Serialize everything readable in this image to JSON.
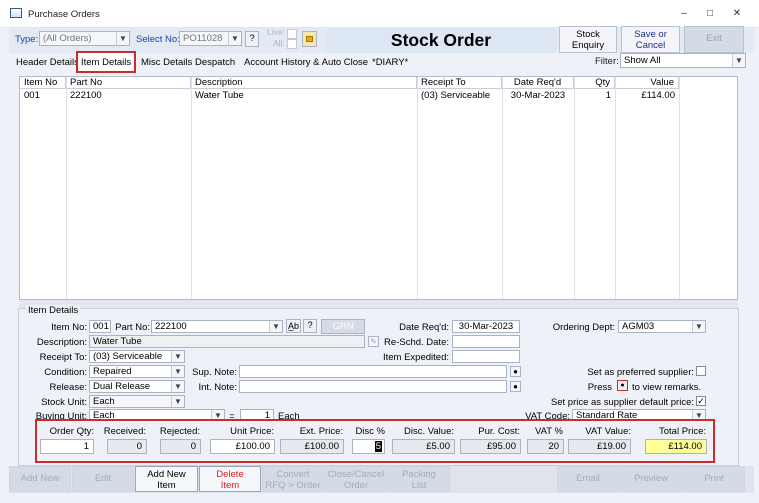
{
  "window": {
    "title": "Purchase Orders",
    "minimize": "–",
    "restore": "□",
    "close": "✕"
  },
  "top": {
    "type_label": "Type:",
    "type_value": "(All Orders)",
    "select_label": "Select No:",
    "select_value": "PO11028",
    "help_btn": "?",
    "live_label": "Live:",
    "all_label": "All:",
    "title": "Stock Order",
    "stock_enquiry": [
      "Stock",
      "Enquiry"
    ],
    "save_cancel": [
      "Save or",
      "Cancel"
    ],
    "exit": "Exit"
  },
  "tabs": [
    "Header Details",
    "Item Details",
    "Misc Details",
    "Despatch",
    "Account History & Auto Close",
    "*DIARY*"
  ],
  "filter": {
    "label": "Filter:",
    "value": "Show All"
  },
  "grid": {
    "columns": [
      "Item No",
      "Part No",
      "Description",
      "Receipt To",
      "Date Req'd",
      "Qty",
      "Value"
    ],
    "rows": [
      [
        "001",
        "222100",
        "Water Tube",
        "(03) Serviceable",
        "30-Mar-2023",
        "1",
        "£114.00"
      ]
    ]
  },
  "details": {
    "legend": "Item Details",
    "item_no_label": "Item No:",
    "item_no": "001",
    "part_no_label": "Part No:",
    "part_no": "222100",
    "ab_btn": "A̲b",
    "q_btn": "?",
    "grn_btn": "GRN",
    "date_reqd_label": "Date Req'd:",
    "date_reqd": "30-Mar-2023",
    "ordering_dept_label": "Ordering Dept:",
    "ordering_dept": "AGM03",
    "description_label": "Description:",
    "description": "Water Tube",
    "reschd_label": "Re-Schd. Date:",
    "reschd": "",
    "receipt_to_label": "Receipt To:",
    "receipt_to": "(03) Serviceable",
    "item_expedited_label": "Item Expedited:",
    "item_expedited": "",
    "condition_label": "Condition:",
    "condition": "Repaired",
    "sup_note_label": "Sup. Note:",
    "sup_note": "",
    "pref_supplier_label": "Set as preferred supplier:",
    "release_label": "Release:",
    "release": "Dual Release",
    "int_note_label": "Int. Note:",
    "int_note": "",
    "press_label": "Press",
    "view_remarks": "to view remarks.",
    "stock_unit_label": "Stock Unit:",
    "stock_unit": "Each",
    "default_price_label": "Set price as supplier default price:",
    "buying_unit_label": "Buying Unit:",
    "buying_unit": "Each",
    "eq": "=",
    "conv_qty": "1",
    "conv_unit": "Each",
    "vat_code_label": "VAT Code:",
    "vat_code": "Standard Rate"
  },
  "totals": {
    "labels": [
      "Order Qty:",
      "Received:",
      "Rejected:",
      "Unit Price:",
      "Ext. Price:",
      "Disc %",
      "Disc. Value:",
      "Pur. Cost:",
      "VAT %",
      "VAT Value:",
      "Total Price:"
    ],
    "values": [
      "1",
      "0",
      "0",
      "£100.00",
      "£100.00",
      "5",
      "£5.00",
      "£95.00",
      "20",
      "£19.00",
      "£114.00"
    ]
  },
  "bottom": {
    "add_new_top": "Add New",
    "edit": "Edit",
    "add_item": [
      "Add New",
      "Item"
    ],
    "delete_item": [
      "Delete",
      "Item"
    ],
    "convert": [
      "Convert",
      "RFQ > Order"
    ],
    "close_cancel": [
      "Close/Cancel",
      "Order"
    ],
    "packing": [
      "Packing",
      "List"
    ],
    "email": "Email",
    "preview": "Preview",
    "print": "Print"
  },
  "colors": {
    "highlight_total": "#ffff99",
    "red_outline": "#cc2b2b",
    "label_blue": "#1e3fa6"
  }
}
